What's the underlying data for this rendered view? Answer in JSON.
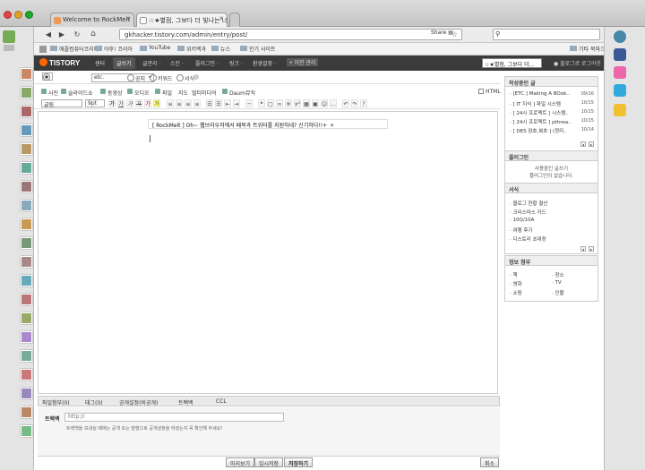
{
  "browser": {
    "tabs": [
      {
        "label": "Welcome to RockMelt"
      },
      {
        "label": "☆★별점, 그보다 더 빛나는 너의 ..."
      }
    ],
    "url": "gkhacker.tistory.com/admin/entry/post/",
    "share_label": "Share",
    "bookmarks": [
      "애플컴퓨터코리아",
      "야후! 코리아",
      "YouTube",
      "위키백과",
      "뉴스",
      "인기 사이트"
    ],
    "other_bookmarks": "기타 북마크"
  },
  "tistory": {
    "logo": "TISTORY",
    "menu": [
      "센터",
      "글쓰기",
      "글관리 ·",
      "스킨 ·",
      "플러그인 ·",
      "링크 ·",
      "환경설정 ·",
      "• 이전 관리"
    ],
    "blog_select": "☆★별점, 그보다 더...",
    "blog_link": "● 블로그로",
    "logout": "로그아웃"
  },
  "editor": {
    "modes": [
      "글",
      "공지",
      "키워드",
      "서식"
    ],
    "category": "etc.",
    "toolbar1": [
      "사진",
      "슬라이드쇼",
      "동영상",
      "오디오",
      "파일",
      "지도",
      "멀티미디어",
      "Daum뮤직"
    ],
    "html_label": "HTML",
    "font_select": "글림",
    "size_select": "9pt",
    "title": "[ RockMelt ] Oh~ 웹브라우저에서 페북과 트위터를 지원하네? 신기하다!!+_+"
  },
  "panel": {
    "recent": {
      "header": "작성중인 글",
      "items": [
        {
          "label": "· [ETC.] Making A BOok..",
          "date": "09/16"
        },
        {
          "label": "· [ IT 지식 ] 파일 시스템",
          "date": "10/15"
        },
        {
          "label": "· [ 24시 프로젝트 ] 시스템..",
          "date": "10/15"
        },
        {
          "label": "· [ 24시 프로젝트 ] pthrea..",
          "date": "10/15"
        },
        {
          "label": "· [ DES 암호,복호 ] (정리..",
          "date": "10/14"
        }
      ]
    },
    "plugin": {
      "header": "플러그인",
      "line1": "사용중인 글쓰기",
      "line2": "플러그인이 없습니다."
    },
    "templates": {
      "header": "서식",
      "items": [
        "· 블로그 현황 결산",
        "· 크리스마스 카드",
        "· 10Q/10A",
        "· 여행 후기",
        "· 디스토리 초대장"
      ]
    },
    "info": {
      "header": "정보 첨부",
      "items": [
        "· 책",
        "· 장소",
        "· 영화",
        "· TV",
        "· 쇼핑",
        "· 인물"
      ]
    }
  },
  "bottom": {
    "tabs": [
      "파일첨부(0)",
      "태그(0)",
      "공개설정(비공개)",
      "트랙백",
      "CCL"
    ],
    "trackback_label": "트랙백",
    "trackback_placeholder": "http://",
    "trackback_help": "트랙백을 보내실 때에는 공개 또는 발행으로 공개설정을 하셨는지 꼭 확인해 주세요!",
    "buttons": [
      "미리보기",
      "임시저장",
      "저장하기"
    ],
    "cancel": "취소"
  }
}
